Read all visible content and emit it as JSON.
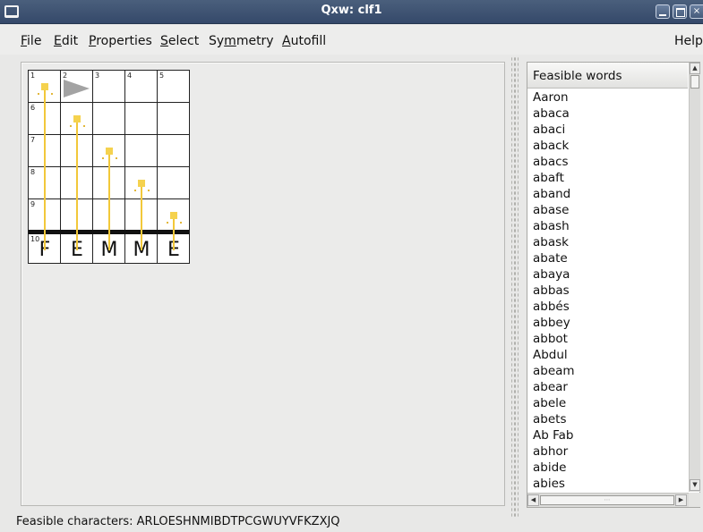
{
  "window": {
    "title": "Qxw: clf1"
  },
  "menu": {
    "items": [
      {
        "id": "file",
        "u": "F",
        "rest": "ile"
      },
      {
        "id": "edit",
        "u": "E",
        "rest": "dit"
      },
      {
        "id": "properties",
        "u": "P",
        "rest": "roperties"
      },
      {
        "id": "select",
        "u": "S",
        "rest": "elect"
      },
      {
        "id": "symmetry",
        "pre": "Sy",
        "u": "m",
        "rest": "metry"
      },
      {
        "id": "autofill",
        "u": "A",
        "rest": "utofill"
      }
    ],
    "help": "Help"
  },
  "grid": {
    "numbers": [
      "1",
      "2",
      "3",
      "4",
      "5",
      "6",
      "7",
      "8",
      "9",
      "10"
    ],
    "bottom_letters": [
      "F",
      "E",
      "M",
      "M",
      "E"
    ]
  },
  "wordlist": {
    "header": "Feasible words",
    "words": [
      "Aaron",
      "abaca",
      "abaci",
      "aback",
      "abacs",
      "abaft",
      "aband",
      "abase",
      "abash",
      "abask",
      "abate",
      "abaya",
      "abbas",
      "abbés",
      "abbey",
      "abbot",
      "Abdul",
      "abeam",
      "abear",
      "abele",
      "abets",
      "Ab Fab",
      "abhor",
      "abide",
      "abies"
    ],
    "hscroll_grip": "⋯"
  },
  "status": {
    "feasible_characters": "Feasible characters: ARLOESHNMIBDTPCGWUYVFKZXJQ"
  },
  "colors": {
    "titlebar": "#3f5375",
    "fill_marker": "#f5d24e",
    "cursor": "#a3a3a3"
  }
}
